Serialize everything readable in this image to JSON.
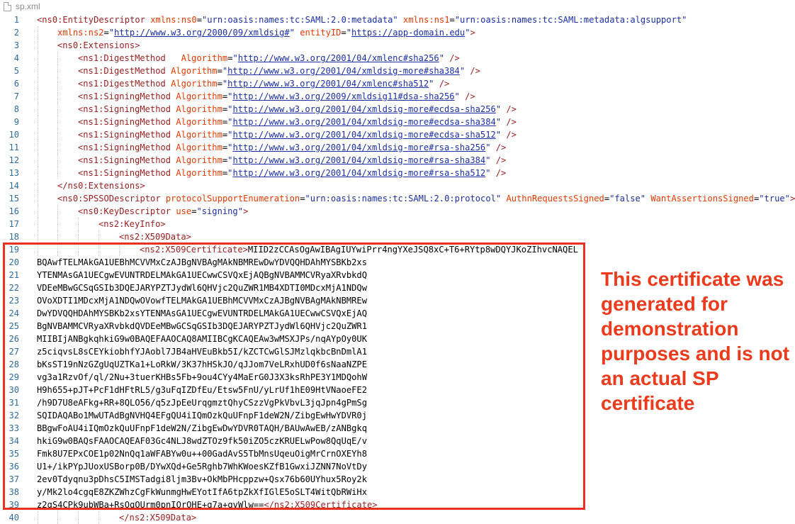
{
  "tab": {
    "filename": "sp.xml",
    "icon": "xml-file-icon"
  },
  "colors": {
    "tag": "#9b1d1d",
    "attribute": "#e63a00",
    "string": "#1b2fa6",
    "line_number": "#2f6c9f",
    "annotation": "#ec3b1c"
  },
  "annotation": "This certificate was generated for demonstration purposes and is not an actual SP certificate",
  "lines": [
    {
      "n": "1",
      "indent": 0,
      "tokens": [
        [
          "tag",
          "<ns0:EntityDescriptor"
        ],
        [
          "plain",
          " "
        ],
        [
          "attr",
          "xmlns:ns0"
        ],
        [
          "eq",
          "="
        ],
        [
          "str",
          "\"urn:oasis:names:tc:SAML:2.0:metadata\""
        ],
        [
          "plain",
          " "
        ],
        [
          "attr",
          "xmlns:ns1"
        ],
        [
          "eq",
          "="
        ],
        [
          "str",
          "\"urn:oasis:names:tc:SAML:metadata:algsupport\""
        ]
      ]
    },
    {
      "n": "2",
      "indent": 1,
      "tokens": [
        [
          "attr",
          "xmlns:ns2"
        ],
        [
          "eq",
          "="
        ],
        [
          "str",
          "\""
        ],
        [
          "url",
          "http://www.w3.org/2000/09/xmldsig#"
        ],
        [
          "str",
          "\""
        ],
        [
          "plain",
          " "
        ],
        [
          "attr",
          "entityID"
        ],
        [
          "eq",
          "="
        ],
        [
          "str",
          "\""
        ],
        [
          "url",
          "https://app-domain.edu"
        ],
        [
          "str",
          "\""
        ],
        [
          "tag",
          ">"
        ]
      ]
    },
    {
      "n": "3",
      "indent": 1,
      "tokens": [
        [
          "tag",
          "<ns0:Extensions>"
        ]
      ]
    },
    {
      "n": "4",
      "indent": 2,
      "tokens": [
        [
          "tag",
          "<ns1:DigestMethod"
        ],
        [
          "plain",
          "   "
        ],
        [
          "attr",
          "Algorithm"
        ],
        [
          "eq",
          "="
        ],
        [
          "str",
          "\""
        ],
        [
          "url",
          "http://www.w3.org/2001/04/xmlenc#sha256"
        ],
        [
          "str",
          "\""
        ],
        [
          "plain",
          " "
        ],
        [
          "tag",
          "/>"
        ]
      ]
    },
    {
      "n": "5",
      "indent": 2,
      "tokens": [
        [
          "tag",
          "<ns1:DigestMethod"
        ],
        [
          "plain",
          " "
        ],
        [
          "attr",
          "Algorithm"
        ],
        [
          "eq",
          "="
        ],
        [
          "str",
          "\""
        ],
        [
          "url",
          "http://www.w3.org/2001/04/xmldsig-more#sha384"
        ],
        [
          "str",
          "\""
        ],
        [
          "plain",
          " "
        ],
        [
          "tag",
          "/>"
        ]
      ]
    },
    {
      "n": "6",
      "indent": 2,
      "tokens": [
        [
          "tag",
          "<ns1:DigestMethod"
        ],
        [
          "plain",
          " "
        ],
        [
          "attr",
          "Algorithm"
        ],
        [
          "eq",
          "="
        ],
        [
          "str",
          "\""
        ],
        [
          "url",
          "http://www.w3.org/2001/04/xmlenc#sha512"
        ],
        [
          "str",
          "\""
        ],
        [
          "plain",
          " "
        ],
        [
          "tag",
          "/>"
        ]
      ]
    },
    {
      "n": "7",
      "indent": 2,
      "tokens": [
        [
          "tag",
          "<ns1:SigningMethod"
        ],
        [
          "plain",
          " "
        ],
        [
          "attr",
          "Algorithm"
        ],
        [
          "eq",
          "="
        ],
        [
          "str",
          "\""
        ],
        [
          "url",
          "http://www.w3.org/2009/xmldsig11#dsa-sha256"
        ],
        [
          "str",
          "\""
        ],
        [
          "plain",
          " "
        ],
        [
          "tag",
          "/>"
        ]
      ]
    },
    {
      "n": "8",
      "indent": 2,
      "tokens": [
        [
          "tag",
          "<ns1:SigningMethod"
        ],
        [
          "plain",
          " "
        ],
        [
          "attr",
          "Algorithm"
        ],
        [
          "eq",
          "="
        ],
        [
          "str",
          "\""
        ],
        [
          "url",
          "http://www.w3.org/2001/04/xmldsig-more#ecdsa-sha256"
        ],
        [
          "str",
          "\""
        ],
        [
          "plain",
          " "
        ],
        [
          "tag",
          "/>"
        ]
      ]
    },
    {
      "n": "9",
      "indent": 2,
      "tokens": [
        [
          "tag",
          "<ns1:SigningMethod"
        ],
        [
          "plain",
          " "
        ],
        [
          "attr",
          "Algorithm"
        ],
        [
          "eq",
          "="
        ],
        [
          "str",
          "\""
        ],
        [
          "url",
          "http://www.w3.org/2001/04/xmldsig-more#ecdsa-sha384"
        ],
        [
          "str",
          "\""
        ],
        [
          "plain",
          " "
        ],
        [
          "tag",
          "/>"
        ]
      ]
    },
    {
      "n": "10",
      "indent": 2,
      "tokens": [
        [
          "tag",
          "<ns1:SigningMethod"
        ],
        [
          "plain",
          " "
        ],
        [
          "attr",
          "Algorithm"
        ],
        [
          "eq",
          "="
        ],
        [
          "str",
          "\""
        ],
        [
          "url",
          "http://www.w3.org/2001/04/xmldsig-more#ecdsa-sha512"
        ],
        [
          "str",
          "\""
        ],
        [
          "plain",
          " "
        ],
        [
          "tag",
          "/>"
        ]
      ]
    },
    {
      "n": "11",
      "indent": 2,
      "tokens": [
        [
          "tag",
          "<ns1:SigningMethod"
        ],
        [
          "plain",
          " "
        ],
        [
          "attr",
          "Algorithm"
        ],
        [
          "eq",
          "="
        ],
        [
          "str",
          "\""
        ],
        [
          "url",
          "http://www.w3.org/2001/04/xmldsig-more#rsa-sha256"
        ],
        [
          "str",
          "\""
        ],
        [
          "plain",
          " "
        ],
        [
          "tag",
          "/>"
        ]
      ]
    },
    {
      "n": "12",
      "indent": 2,
      "tokens": [
        [
          "tag",
          "<ns1:SigningMethod"
        ],
        [
          "plain",
          " "
        ],
        [
          "attr",
          "Algorithm"
        ],
        [
          "eq",
          "="
        ],
        [
          "str",
          "\""
        ],
        [
          "url",
          "http://www.w3.org/2001/04/xmldsig-more#rsa-sha384"
        ],
        [
          "str",
          "\""
        ],
        [
          "plain",
          " "
        ],
        [
          "tag",
          "/>"
        ]
      ]
    },
    {
      "n": "13",
      "indent": 2,
      "tokens": [
        [
          "tag",
          "<ns1:SigningMethod"
        ],
        [
          "plain",
          " "
        ],
        [
          "attr",
          "Algorithm"
        ],
        [
          "eq",
          "="
        ],
        [
          "str",
          "\""
        ],
        [
          "url",
          "http://www.w3.org/2001/04/xmldsig-more#rsa-sha512"
        ],
        [
          "str",
          "\""
        ],
        [
          "plain",
          " "
        ],
        [
          "tag",
          "/>"
        ]
      ]
    },
    {
      "n": "14",
      "indent": 1,
      "tokens": [
        [
          "tag",
          "</ns0:Extensions>"
        ]
      ]
    },
    {
      "n": "15",
      "indent": 1,
      "tokens": [
        [
          "tag",
          "<ns0:SPSSODescriptor"
        ],
        [
          "plain",
          " "
        ],
        [
          "attr",
          "protocolSupportEnumeration"
        ],
        [
          "eq",
          "="
        ],
        [
          "str",
          "\"urn:oasis:names:tc:SAML:2.0:protocol\""
        ],
        [
          "plain",
          " "
        ],
        [
          "attr",
          "AuthnRequestsSigned"
        ],
        [
          "eq",
          "="
        ],
        [
          "str",
          "\"false\""
        ],
        [
          "plain",
          " "
        ],
        [
          "attr",
          "WantAssertionsSigned"
        ],
        [
          "eq",
          "="
        ],
        [
          "str",
          "\"true\""
        ],
        [
          "tag",
          ">"
        ]
      ]
    },
    {
      "n": "16",
      "indent": 2,
      "tokens": [
        [
          "tag",
          "<ns0:KeyDescriptor"
        ],
        [
          "plain",
          " "
        ],
        [
          "attr",
          "use"
        ],
        [
          "eq",
          "="
        ],
        [
          "str",
          "\"signing\""
        ],
        [
          "tag",
          ">"
        ]
      ]
    },
    {
      "n": "17",
      "indent": 3,
      "tokens": [
        [
          "tag",
          "<ns2:KeyInfo>"
        ]
      ]
    },
    {
      "n": "18",
      "indent": 4,
      "tokens": [
        [
          "tag",
          "<ns2:X509Data>"
        ]
      ]
    },
    {
      "n": "19",
      "indent": 5,
      "tokens": [
        [
          "tag",
          "<ns2:X509Certificate>"
        ],
        [
          "plain",
          "MIID2zCCAsOgAwIBAgIUYwiPrr4ngYXeJSQ8xC+T6+RYtp8wDQYJKoZIhvcNAQEL"
        ]
      ]
    },
    {
      "n": "20",
      "indent": 0,
      "tokens": [
        [
          "plain",
          "BQAwfTELMAkGA1UEBhMCVVMxCzAJBgNVBAgMAkNBMREwDwYDVQQHDAhMYSBKb2xs"
        ]
      ]
    },
    {
      "n": "21",
      "indent": 0,
      "tokens": [
        [
          "plain",
          "YTENMAsGA1UECgwEVUNTRDELMAkGA1UECwwCSVQxEjAQBgNVBAMMCVRyaXRvbkdQ"
        ]
      ]
    },
    {
      "n": "22",
      "indent": 0,
      "tokens": [
        [
          "plain",
          "VDEeMBwGCSqGSIb3DQEJARYPZTJydWl6QHVjc2QuZWR1MB4XDTI0MDcxMjA1NDQw"
        ]
      ]
    },
    {
      "n": "23",
      "indent": 0,
      "tokens": [
        [
          "plain",
          "OVoXDTI1MDcxMjA1NDQwOVowfTELMAkGA1UEBhMCVVMxCzAJBgNVBAgMAkNBMREw"
        ]
      ]
    },
    {
      "n": "24",
      "indent": 0,
      "tokens": [
        [
          "plain",
          "DwYDVQQHDAhMYSBKb2xsYTENMAsGA1UECgwEVUNTRDELMAkGA1UECwwCSVQxEjAQ"
        ]
      ]
    },
    {
      "n": "25",
      "indent": 0,
      "tokens": [
        [
          "plain",
          "BgNVBAMMCVRyaXRvbkdQVDEeMBwGCSqGSIb3DQEJARYPZTJydWl6QHVjc2QuZWR1"
        ]
      ]
    },
    {
      "n": "26",
      "indent": 0,
      "tokens": [
        [
          "plain",
          "MIIBIjANBgkqhkiG9w0BAQEFAAOCAQ8AMIIBCgKCAQEAw3wMSXJPs/nqAYpOy0UK"
        ]
      ]
    },
    {
      "n": "27",
      "indent": 0,
      "tokens": [
        [
          "plain",
          "z5ciqvsL8sCEYkiobhfYJAobl7JB4aHVEuBkb5I/kZCTCwGlSJMzlqkbcBnDmlA1"
        ]
      ]
    },
    {
      "n": "28",
      "indent": 0,
      "tokens": [
        [
          "plain",
          "bKsST19nNzGZgUqUZTKa1+LoRkW/3K37hHSkJO/qJJom7VeLRxhUD0f6sNaaNZPE"
        ]
      ]
    },
    {
      "n": "29",
      "indent": 0,
      "tokens": [
        [
          "plain",
          "vg3a1RzvOf/ql/2Nu+3tuerKHBs5Fb+9ou4CYy4MaErG0J3X3ksRhPE3Y1MDQohW"
        ]
      ]
    },
    {
      "n": "30",
      "indent": 0,
      "tokens": [
        [
          "plain",
          "H9h655+pJT+PcF1dHFtRL5/g3uFqIZDfEu/Etsw5FnU/yLrUf1hE09HtVNaoeFE2"
        ]
      ]
    },
    {
      "n": "31",
      "indent": 0,
      "tokens": [
        [
          "plain",
          "/h9D7U8eAFkg+RR+8QLO56/q5zJpEeUrqgmztQhyCSzzVgPkVbvL3jqJpn4gPmSg"
        ]
      ]
    },
    {
      "n": "32",
      "indent": 0,
      "tokens": [
        [
          "plain",
          "SQIDAQABo1MwUTAdBgNVHQ4EFgQU4iIQmOzkQuUFnpF1deW2N/ZibgEwHwYDVR0j"
        ]
      ]
    },
    {
      "n": "33",
      "indent": 0,
      "tokens": [
        [
          "plain",
          "BBgwFoAU4iIQmOzkQuUFnpF1deW2N/ZibgEwDwYDVR0TAQH/BAUwAwEB/zANBgkq"
        ]
      ]
    },
    {
      "n": "34",
      "indent": 0,
      "tokens": [
        [
          "plain",
          "hkiG9w0BAQsFAAOCAQEAF03Gc4NLJ8wdZTOz9fk50iZO5czKRUELwPow8QqUqE/v"
        ]
      ]
    },
    {
      "n": "35",
      "indent": 0,
      "tokens": [
        [
          "plain",
          "Fmk8U7EPxCOE1p02NnQq1aWFABYw0u++00GadAvS5TbMnsUqeuOigMrCrnOXEYh8"
        ]
      ]
    },
    {
      "n": "36",
      "indent": 0,
      "tokens": [
        [
          "plain",
          "U1+/ikPYpJUoxUSBorp0B/DYwXQd+Ge5Rghb7WhKWoesKZfB1GwxiJZNN7NoVtDy"
        ]
      ]
    },
    {
      "n": "37",
      "indent": 0,
      "tokens": [
        [
          "plain",
          "2ev0Tdyqnu3pDhsC5IMSTadgi8ljm3Bv+OkMbPHcppzw+Qsx76b60UYhux5Roy2k"
        ]
      ]
    },
    {
      "n": "38",
      "indent": 0,
      "tokens": [
        [
          "plain",
          "y/Mk2lo4cgqE8ZKZWhzCgFkWunmgHwEYotIfA6tpZkXfIGlE5oSLT4WitQbRWiHx"
        ]
      ]
    },
    {
      "n": "39",
      "indent": 0,
      "tokens": [
        [
          "plain",
          "z2qS4CPk9ubWBa+RsOqOUrm0pnIOrOHE+g7a+gvWlw=="
        ],
        [
          "tag",
          "</ns2:X509Certificate>"
        ]
      ]
    },
    {
      "n": "40",
      "indent": 4,
      "tokens": [
        [
          "tag",
          "</ns2:X509Data>"
        ]
      ]
    }
  ]
}
